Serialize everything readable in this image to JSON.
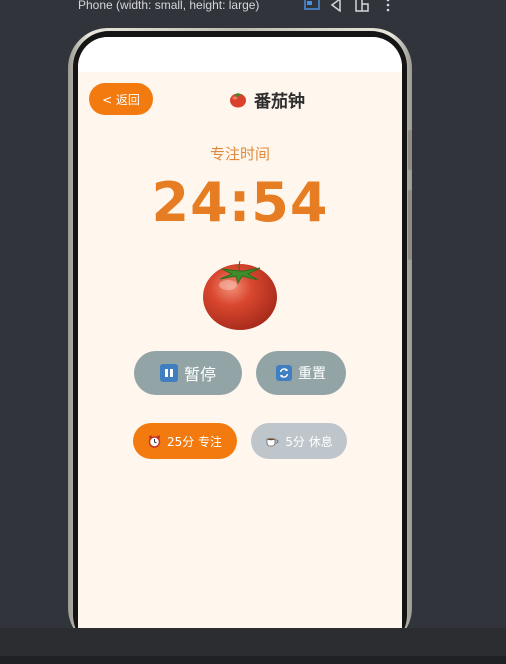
{
  "toolbar": {
    "device_label": "Phone (width: small, height: large)"
  },
  "header": {
    "back_label": "< 返回",
    "title": "番茄钟"
  },
  "timer": {
    "label": "专注时间",
    "time": "24:54"
  },
  "controls": {
    "pause_label": "暂停",
    "reset_label": "重置"
  },
  "modes": {
    "focus_label": "25分 专注",
    "break_label": "5分 休息"
  },
  "colors": {
    "accent": "#f37a0f",
    "timer": "#e67d22",
    "background": "#fff6ee",
    "control": "#92a4a6",
    "inactive": "#bec6cc"
  },
  "icons": {
    "title_icon": "tomato-icon",
    "pause_icon": "pause-icon",
    "reset_icon": "refresh-icon",
    "focus_icon": "alarm-clock-icon",
    "break_icon": "coffee-icon"
  }
}
